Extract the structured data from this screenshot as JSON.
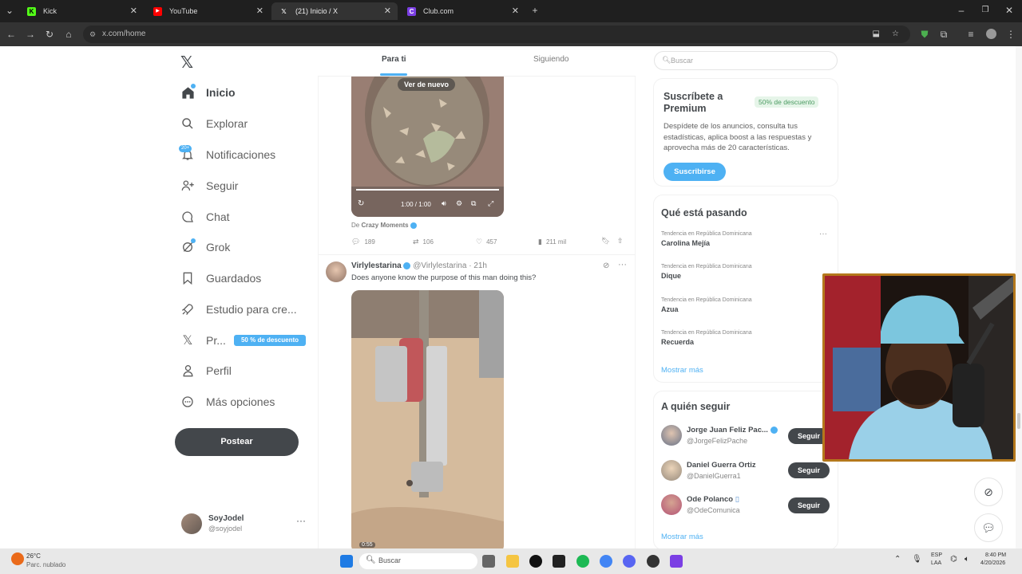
{
  "browser": {
    "tabs": [
      {
        "label": "Kick",
        "icon": "kick-icon",
        "color": "#53fc18"
      },
      {
        "label": "YouTube",
        "icon": "youtube-icon",
        "color": "#ff0000"
      },
      {
        "label": "(21) Inicio / X",
        "icon": "x-icon",
        "color": "#ffffff"
      },
      {
        "label": "Club.com",
        "icon": "club-icon",
        "color": "#7b3fe4"
      }
    ],
    "url": "x.com/home"
  },
  "sidebar": {
    "items": [
      {
        "label": "Inicio",
        "icon": "home-icon"
      },
      {
        "label": "Explorar",
        "icon": "search-icon"
      },
      {
        "label": "Notificaciones",
        "icon": "bell-icon",
        "badge": "20+"
      },
      {
        "label": "Seguir",
        "icon": "add-user-icon"
      },
      {
        "label": "Chat",
        "icon": "chat-icon"
      },
      {
        "label": "Grok",
        "icon": "grok-icon"
      },
      {
        "label": "Guardados",
        "icon": "bookmark-icon"
      },
      {
        "label": "Estudio para cre...",
        "icon": "rocket-icon"
      },
      {
        "label": "Pr...",
        "icon": "x-icon",
        "badge": "50 % de descuento"
      },
      {
        "label": "Perfil",
        "icon": "person-icon"
      },
      {
        "label": "Más opciones",
        "icon": "more-circle-icon"
      }
    ],
    "post_label": "Postear",
    "account": {
      "name": "SoyJodel",
      "handle": "@soyjodel"
    }
  },
  "feed": {
    "tabs": [
      "Para ti",
      "Siguiendo"
    ],
    "post1": {
      "replay_label": "Ver de nuevo",
      "time": "1:00 / 1:00",
      "source_prefix": "De",
      "source_name": "Crazy Moments",
      "replies": "189",
      "reposts": "106",
      "likes": "457",
      "views": "211 mil"
    },
    "post2": {
      "name": "Virlylestarina",
      "handle": "@Virlylestarina · 21h",
      "text": "Does anyone know the purpose of this man doing this?",
      "duration": "0:55"
    }
  },
  "right": {
    "search_placeholder": "Buscar",
    "premium": {
      "title": "Suscríbete a Premium",
      "discount": "50% de descuento",
      "desc": "Despídete de los anuncios, consulta tus estadísticas, aplica boost a las respuestas y aprovecha más de 20 características.",
      "button": "Suscribirse"
    },
    "trends_title": "Qué está pasando",
    "trends": [
      {
        "meta": "Tendencia en República Dominicana",
        "name": "Carolina Mejía"
      },
      {
        "meta": "Tendencia en República Dominicana",
        "name": "Dique"
      },
      {
        "meta": "Tendencia en República Dominicana",
        "name": "Azua"
      },
      {
        "meta": "Tendencia en República Dominicana",
        "name": "Recuerda"
      }
    ],
    "show_more": "Mostrar más",
    "follow_title": "A quién seguir",
    "follow": [
      {
        "name": "Jorge Juan Feliz Pac...",
        "handle": "@JorgeFelizPache",
        "button": "Seguir"
      },
      {
        "name": "Daniel Guerra Ortiz",
        "handle": "@DanielGuerra1",
        "button": "Seguir"
      },
      {
        "name": "Ode Polanco",
        "handle": "@OdeComunica",
        "button": "Seguir"
      }
    ],
    "show_more2": "Mostrar más"
  },
  "taskbar": {
    "weather_temp": "26°C",
    "weather_desc": "Parc. nublado",
    "search": "Buscar",
    "lang1": "ESP",
    "lang2": "LAA",
    "time": "8:40 PM",
    "date": "4/20/2026"
  }
}
